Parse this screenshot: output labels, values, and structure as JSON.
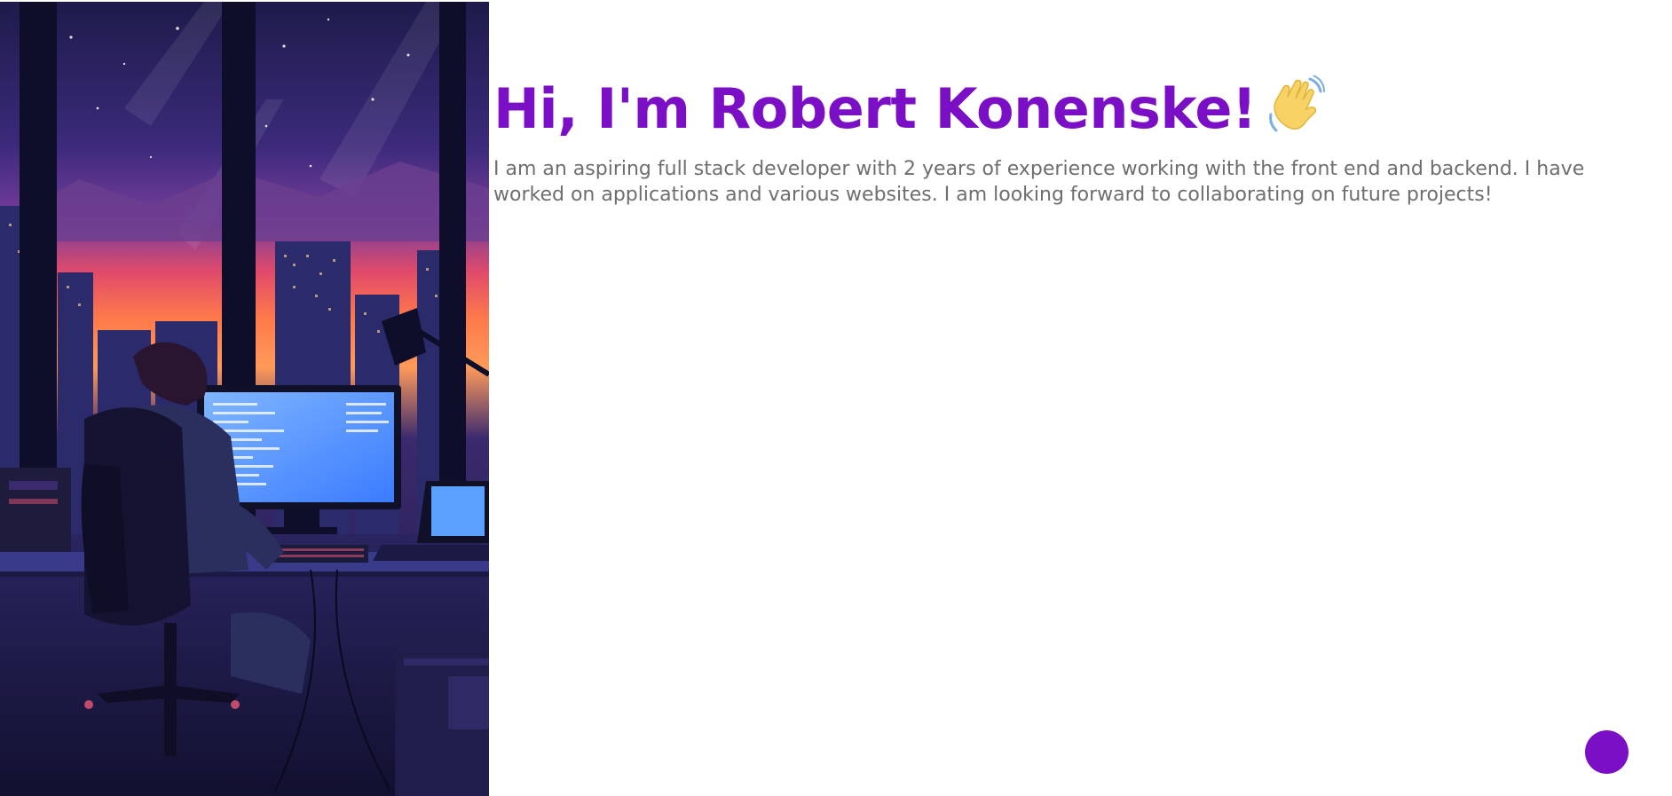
{
  "hero": {
    "image_name": "developer-at-desk-night-city-illustration"
  },
  "intro": {
    "headline": "Hi, I'm Robert Konenske!",
    "headline_icon": "waving-hand-icon",
    "bio": "I am an aspiring full stack developer with 2 years of experience working with the front end and backend. I have worked on applications and various websites. I am looking forward to collaborating on future projects!"
  },
  "theme": {
    "accent": "#7b0fc6",
    "body_text": "#6e6e6e"
  },
  "fab": {
    "icon": "circle-button-icon"
  }
}
